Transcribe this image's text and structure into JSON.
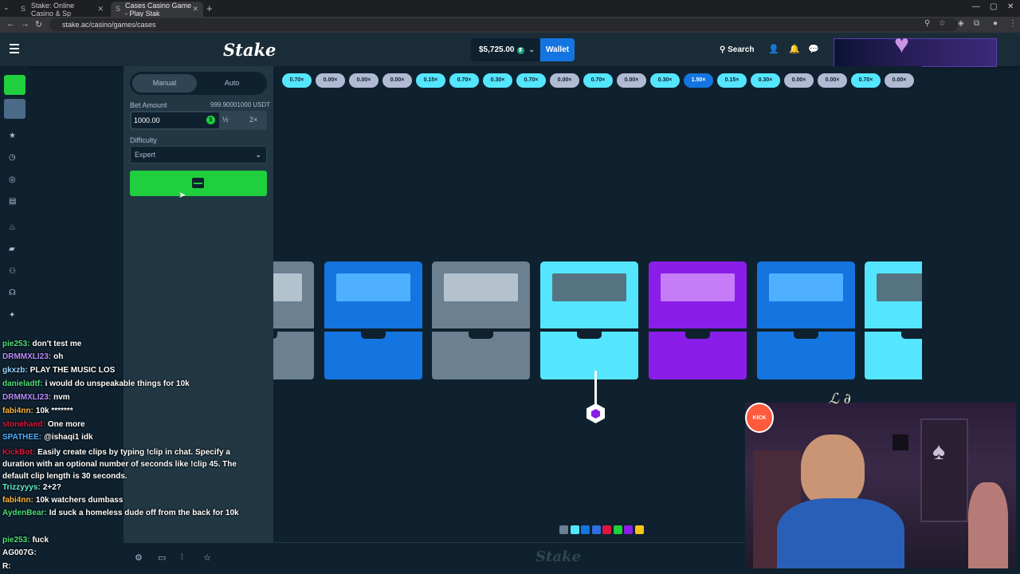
{
  "browser": {
    "tabs": [
      {
        "title": "Stake: Online Casino & Sp",
        "active": false
      },
      {
        "title": "Cases Casino Game - Play Stak",
        "active": true
      }
    ],
    "url": "stake.ac/casino/games/cases"
  },
  "header": {
    "logo": "Stake",
    "balance": "$5,725.00",
    "wallet_label": "Wallet",
    "search_label": "Search"
  },
  "controls": {
    "tabs": [
      "Manual",
      "Auto"
    ],
    "active_tab": "Manual",
    "bet_amount_label": "Bet Amount",
    "bet_amount_usdt": "999.90001000 USDT",
    "bet_value": "1000.00",
    "half_label": "½",
    "double_label": "2×",
    "difficulty_label": "Difficulty",
    "difficulty_value": "Expert"
  },
  "multipliers": [
    {
      "value": "0.70×",
      "tier": "mid"
    },
    {
      "value": "0.00×",
      "tier": "lo"
    },
    {
      "value": "0.00×",
      "tier": "lo"
    },
    {
      "value": "0.00×",
      "tier": "lo"
    },
    {
      "value": "0.15×",
      "tier": "mid"
    },
    {
      "value": "0.70×",
      "tier": "mid"
    },
    {
      "value": "0.30×",
      "tier": "mid"
    },
    {
      "value": "0.70×",
      "tier": "mid"
    },
    {
      "value": "0.00×",
      "tier": "lo"
    },
    {
      "value": "0.70×",
      "tier": "mid"
    },
    {
      "value": "0.00×",
      "tier": "lo"
    },
    {
      "value": "0.30×",
      "tier": "mid"
    },
    {
      "value": "1.50×",
      "tier": "hi"
    },
    {
      "value": "0.15×",
      "tier": "mid"
    },
    {
      "value": "0.30×",
      "tier": "mid"
    },
    {
      "value": "0.00×",
      "tier": "lo"
    },
    {
      "value": "0.00×",
      "tier": "lo"
    },
    {
      "value": "0.70×",
      "tier": "mid"
    },
    {
      "value": "0.00×",
      "tier": "lo"
    }
  ],
  "crates": [
    "gray",
    "blue",
    "gray",
    "cyan",
    "purple",
    "blue",
    "cyan"
  ],
  "legend_colors": [
    "#6b8192",
    "#55e6ff",
    "#1475e1",
    "#2f6fe0",
    "#e0163f",
    "#1fcf3d",
    "#8a1ee8",
    "#f5c518"
  ],
  "chat": [
    {
      "user": "pie253",
      "color": "#4fe07a",
      "text": "don't test me"
    },
    {
      "user": "DRMMXLI23",
      "color": "#b98cff",
      "text": "oh"
    },
    {
      "user": "gkxzb",
      "color": "#9ad7ff",
      "text": "PLAY THE MUSIC LOS"
    },
    {
      "user": "danieladtf",
      "color": "#4fe07a",
      "text": "i would do unspeakable things for 10k"
    },
    {
      "user": "DRMMXLI23",
      "color": "#b98cff",
      "text": "nvm"
    },
    {
      "user": "fabi4nn",
      "color": "#ffb43c",
      "text": "10k *******"
    },
    {
      "user": "stonehand",
      "color": "#e0163f",
      "text": "One more"
    },
    {
      "user": "SPATHEE",
      "color": "#4fb0ff",
      "text": "@ishaqi1 idk"
    },
    {
      "user": "KickBot",
      "color": "#e0163f",
      "text": "Easily create clips by typing !clip in chat. Specify a duration with an optional number of seconds like !clip 45. The default clip length is 30 seconds."
    },
    {
      "user": "Trizzyyys",
      "color": "#5ef0d0",
      "text": "2+2?"
    },
    {
      "user": "fabi4nn",
      "color": "#ffb43c",
      "text": "10k watchers dumbass"
    },
    {
      "user": "AydenBear",
      "color": "#4fe07a",
      "text": "Id suck a homeless dude off from the back for 10k"
    },
    {
      "user": "pie253",
      "color": "#4fe07a",
      "text": "fuck"
    },
    {
      "user": "AG007G",
      "color": "#fff",
      "text": ""
    },
    {
      "user": "R",
      "color": "#fff",
      "text": ""
    }
  ]
}
